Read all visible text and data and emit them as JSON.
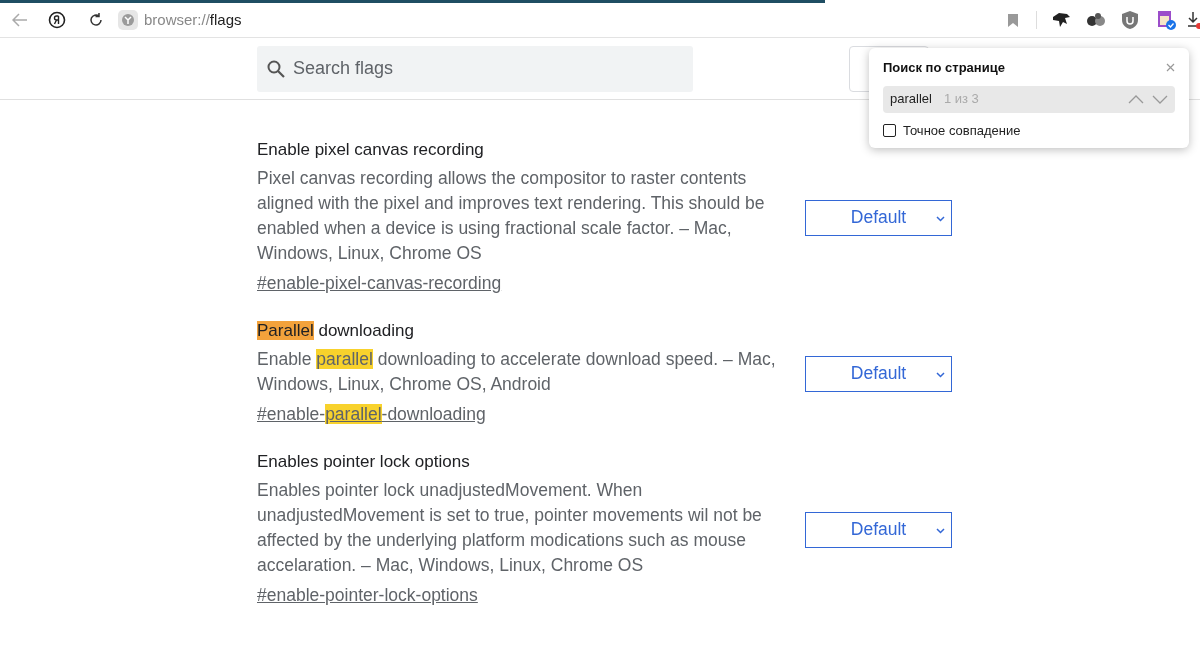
{
  "address_bar": {
    "scheme": "browser://",
    "path": "flags"
  },
  "search": {
    "placeholder": "Search flags"
  },
  "find_popup": {
    "title": "Поиск по странице",
    "query": "parallel",
    "count": "1 из 3",
    "exact_match": {
      "label": "Точное совпадение",
      "checked": false
    }
  },
  "flags": [
    {
      "title": [
        {
          "text": "Enable pixel canvas recording",
          "highlighted": false
        }
      ],
      "description": [
        {
          "text": "Pixel canvas recording allows the compositor to raster contents aligned with the pixel and improves text rendering. This should be enabled when a device is using fractional scale factor. – Mac, Windows, Linux, Chrome OS",
          "highlighted": false
        }
      ],
      "link": [
        {
          "text": "#enable-pixel-canvas-recording",
          "highlighted": false
        }
      ],
      "select": "Default"
    },
    {
      "title": [
        {
          "text": "Parallel",
          "highlighted": true,
          "current": true
        },
        {
          "text": " downloading",
          "highlighted": false
        }
      ],
      "description": [
        {
          "text": "Enable ",
          "highlighted": false
        },
        {
          "text": "parallel",
          "highlighted": true,
          "current": false
        },
        {
          "text": " downloading to accelerate download speed. – Mac, Windows, Linux, Chrome OS, Android",
          "highlighted": false
        }
      ],
      "link": [
        {
          "text": "#enable-",
          "highlighted": false
        },
        {
          "text": "parallel",
          "highlighted": true,
          "current": false
        },
        {
          "text": "-downloading",
          "highlighted": false
        }
      ],
      "select": "Default"
    },
    {
      "title": [
        {
          "text": "Enables pointer lock options",
          "highlighted": false
        }
      ],
      "description": [
        {
          "text": "Enables pointer lock unadjustedMovement. When unadjustedMovement is set to true, pointer movements wil not be affected by the underlying platform modications such as mouse accelaration. – Mac, Windows, Linux, Chrome OS",
          "highlighted": false
        }
      ],
      "link": [
        {
          "text": "#enable-pointer-lock-options",
          "highlighted": false
        }
      ],
      "select": "Default"
    }
  ]
}
